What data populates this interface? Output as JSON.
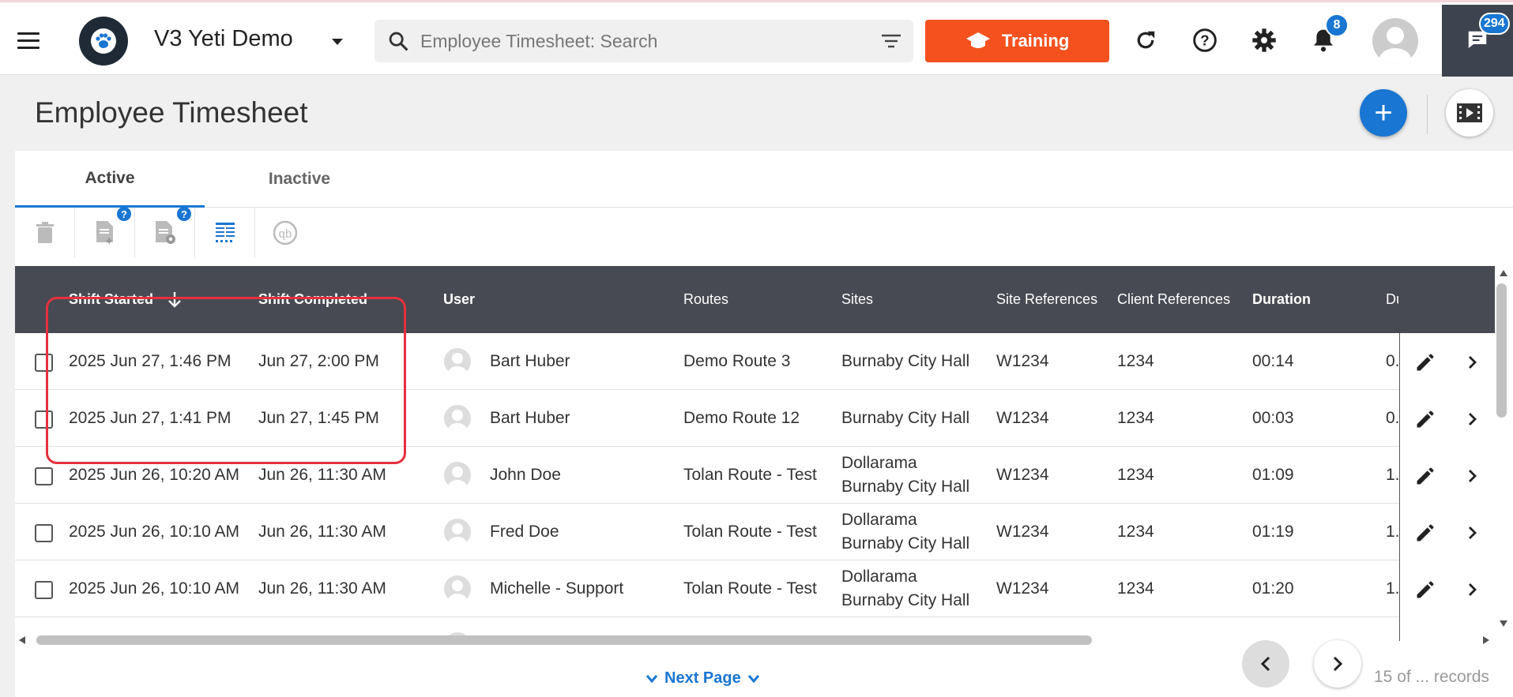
{
  "topbar": {
    "app_title": "V3 Yeti Demo",
    "search_placeholder": "Employee Timesheet: Search",
    "training_label": "Training",
    "notifications_count": "8",
    "messages_count": "294"
  },
  "page": {
    "title": "Employee Timesheet",
    "add_label": "+"
  },
  "tabs": [
    {
      "label": "Active",
      "active": true
    },
    {
      "label": "Inactive",
      "active": false
    }
  ],
  "toolbar": {
    "help_mark": "?"
  },
  "table": {
    "columns": [
      "Shift Started",
      "Shift Completed",
      "User",
      "Routes",
      "Sites",
      "Site References",
      "Client References",
      "Duration",
      "Du"
    ],
    "rows": [
      {
        "shift_started": "2025 Jun 27, 1:46 PM",
        "shift_completed": "Jun 27, 2:00 PM",
        "user": "Bart Huber",
        "routes": "Demo Route 3",
        "sites": [
          "Burnaby City Hall"
        ],
        "site_ref": "W1234",
        "client_ref": "1234",
        "duration": "00:14",
        "du": "0."
      },
      {
        "shift_started": "2025 Jun 27, 1:41 PM",
        "shift_completed": "Jun 27, 1:45 PM",
        "user": "Bart Huber",
        "routes": "Demo Route 12",
        "sites": [
          "Burnaby City Hall"
        ],
        "site_ref": "W1234",
        "client_ref": "1234",
        "duration": "00:03",
        "du": "0."
      },
      {
        "shift_started": "2025 Jun 26, 10:20 AM",
        "shift_completed": "Jun 26, 11:30 AM",
        "user": "John Doe",
        "routes": "Tolan Route - Test",
        "sites": [
          "Dollarama",
          "Burnaby City Hall"
        ],
        "site_ref": "W1234",
        "client_ref": "1234",
        "duration": "01:09",
        "du": "1."
      },
      {
        "shift_started": "2025 Jun 26, 10:10 AM",
        "shift_completed": "Jun 26, 11:30 AM",
        "user": "Fred Doe",
        "routes": "Tolan Route - Test",
        "sites": [
          "Dollarama",
          "Burnaby City Hall"
        ],
        "site_ref": "W1234",
        "client_ref": "1234",
        "duration": "01:19",
        "du": "1."
      },
      {
        "shift_started": "2025 Jun 26, 10:10 AM",
        "shift_completed": "Jun 26, 11:30 AM",
        "user": "Michelle - Support",
        "routes": "Tolan Route - Test",
        "sites": [
          "Dollarama",
          "Burnaby City Hall"
        ],
        "site_ref": "W1234",
        "client_ref": "1234",
        "duration": "01:20",
        "du": "1."
      }
    ]
  },
  "footer": {
    "next_page_label": "Next Page",
    "records_label": "15 of ... records"
  },
  "colors": {
    "training_bg": "#f4511e",
    "accent": "#1976d2",
    "header_bg": "#474a52",
    "highlight": "#e5303e"
  }
}
